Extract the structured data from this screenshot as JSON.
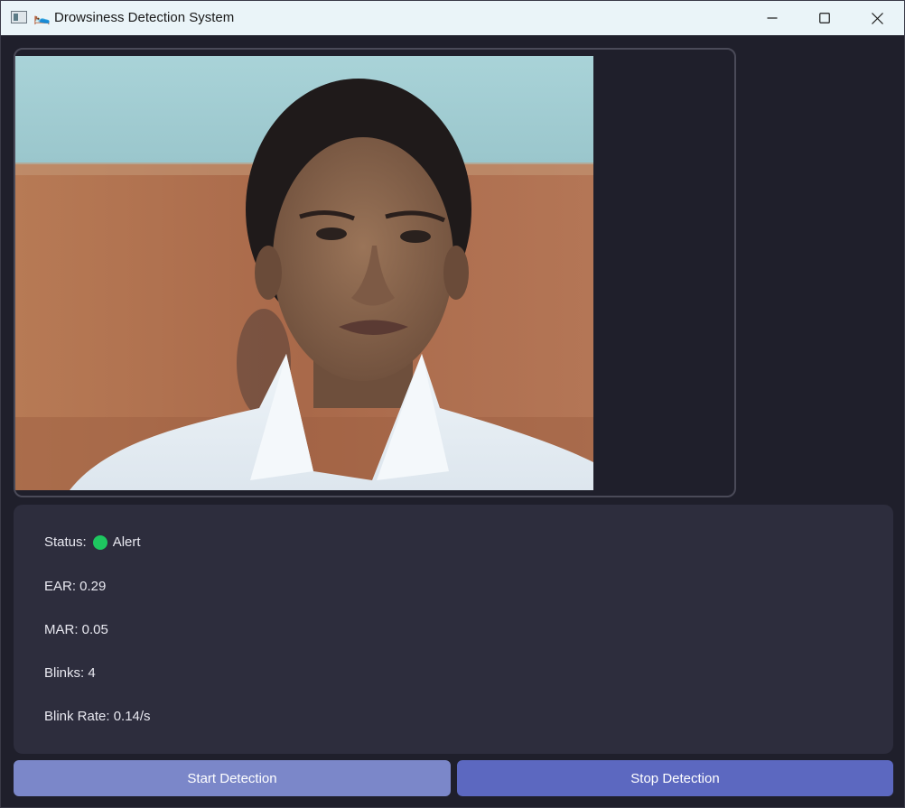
{
  "window": {
    "title": "Drowsiness Detection System",
    "title_emoji": "🛌",
    "app_icon": "window-app-icon",
    "controls": {
      "minimize_icon": "minimize-icon",
      "maximize_icon": "maximize-icon",
      "close_icon": "close-icon"
    }
  },
  "stats": {
    "status_label": "Status:",
    "status_value": "Alert",
    "status_color": "#1ec760",
    "ear": "EAR: 0.29",
    "mar": "MAR: 0.05",
    "blinks": "Blinks: 4",
    "blink_rate": "Blink Rate: 0.14/s"
  },
  "buttons": {
    "start_label": "Start Detection",
    "stop_label": "Stop Detection"
  },
  "colors": {
    "background": "#1f1f2b",
    "panel": "#2d2d3d",
    "start_button": "#7b87c9",
    "stop_button": "#5c68c0"
  }
}
